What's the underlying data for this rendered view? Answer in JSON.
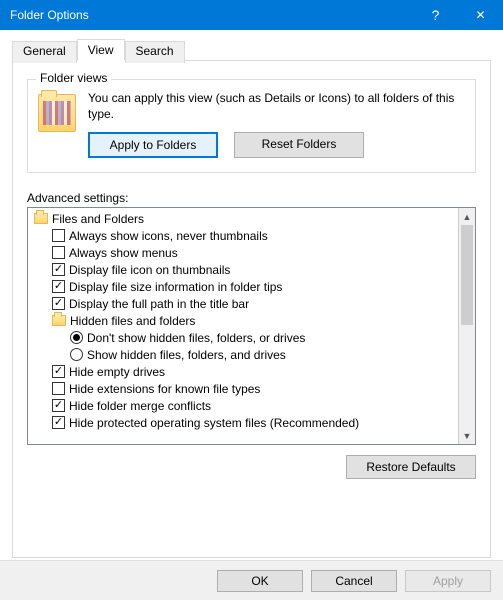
{
  "titlebar": {
    "title": "Folder Options"
  },
  "tabs": {
    "general": "General",
    "view": "View",
    "search": "Search"
  },
  "folderViews": {
    "legend": "Folder views",
    "description": "You can apply this view (such as Details or Icons) to all folders of this type.",
    "applyBtn": "Apply to Folders",
    "resetBtn": "Reset Folders"
  },
  "advanced": {
    "label": "Advanced settings:",
    "items": [
      {
        "type": "folder",
        "indent": 0,
        "label": "Files and Folders"
      },
      {
        "type": "check",
        "indent": 1,
        "checked": false,
        "label": "Always show icons, never thumbnails"
      },
      {
        "type": "check",
        "indent": 1,
        "checked": false,
        "label": "Always show menus"
      },
      {
        "type": "check",
        "indent": 1,
        "checked": true,
        "label": "Display file icon on thumbnails"
      },
      {
        "type": "check",
        "indent": 1,
        "checked": true,
        "label": "Display file size information in folder tips"
      },
      {
        "type": "check",
        "indent": 1,
        "checked": true,
        "label": "Display the full path in the title bar"
      },
      {
        "type": "folder",
        "indent": 1,
        "label": "Hidden files and folders"
      },
      {
        "type": "radio",
        "indent": 2,
        "checked": true,
        "label": "Don't show hidden files, folders, or drives"
      },
      {
        "type": "radio",
        "indent": 2,
        "checked": false,
        "label": "Show hidden files, folders, and drives"
      },
      {
        "type": "check",
        "indent": 1,
        "checked": true,
        "label": "Hide empty drives"
      },
      {
        "type": "check",
        "indent": 1,
        "checked": false,
        "label": "Hide extensions for known file types"
      },
      {
        "type": "check",
        "indent": 1,
        "checked": true,
        "label": "Hide folder merge conflicts"
      },
      {
        "type": "check",
        "indent": 1,
        "checked": true,
        "label": "Hide protected operating system files (Recommended)"
      }
    ],
    "restoreBtn": "Restore Defaults"
  },
  "footer": {
    "ok": "OK",
    "cancel": "Cancel",
    "apply": "Apply"
  }
}
